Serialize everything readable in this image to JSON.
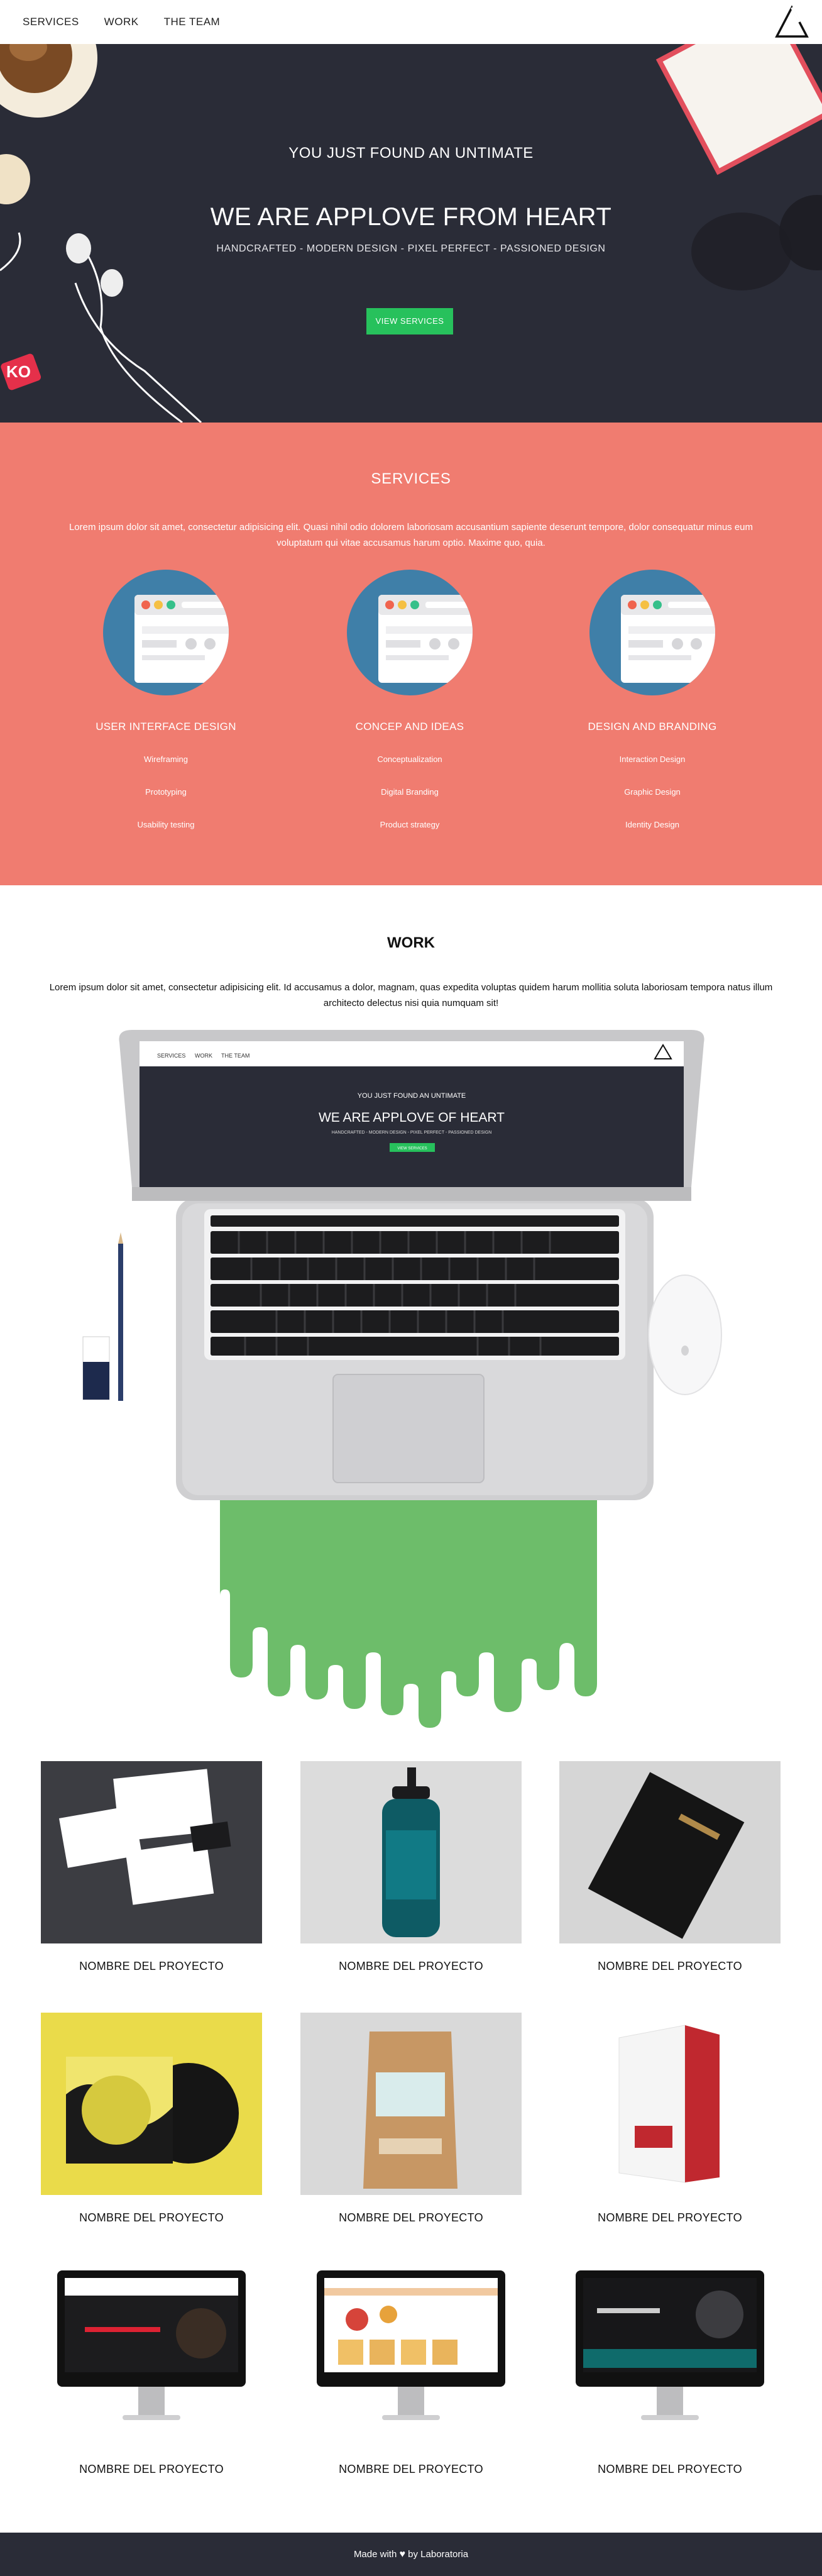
{
  "nav": {
    "items": [
      "SERVICES",
      "WORK",
      "THE TEAM"
    ],
    "logo_icon": "triangle-logo-icon"
  },
  "hero": {
    "pretitle": "YOU JUST FOUND AN UNTIMATE",
    "title": "WE ARE APPLOVE FROM HEART",
    "subtitle": "HANDCRAFTED - MODERN DESIGN - PIXEL PERFECT - PASSIONED DESIGN",
    "button": "VIEW SERVICES",
    "button_color": "#27c15c",
    "background": "#2a2c37"
  },
  "services": {
    "title": "SERVICES",
    "lead": "Lorem ipsum dolor sit amet, consectetur adipisicing elit. Quasi nihil odio dolorem laboriosam accusantium sapiente deserunt tempore, dolor consequatur minus eum voluptatum qui vitae accusamus harum optio. Maxime quo, quia.",
    "background": "#f07c70",
    "columns": [
      {
        "title": "USER INTERFACE DESIGN",
        "items": [
          "Wireframing",
          "Prototyping",
          "Usability testing"
        ]
      },
      {
        "title": "CONCEP AND IDEAS",
        "items": [
          "Conceptualization",
          "Digital Branding",
          "Product strategy"
        ]
      },
      {
        "title": "DESIGN AND BRANDING",
        "items": [
          "Interaction Design",
          "Graphic Design",
          "Identity Design"
        ]
      }
    ]
  },
  "work": {
    "title": "WORK",
    "lead": "Lorem ipsum dolor sit amet, consectetur adipisicing elit. Id accusamus a dolor, magnam, quas expedita voluptas quidem harum mollitia soluta laboriosam tempora natus illum architecto delectus nisi quia numquam sit!",
    "screen": {
      "nav": [
        "SERVICES",
        "WORK",
        "THE TEAM"
      ],
      "pretitle": "YOU JUST FOUND AN UNTIMATE",
      "title": "WE ARE APPLOVE OF HEART",
      "subtitle": "HANDCRAFTED - MODERN DESIGN - PIXEL PERFECT - PASSIONED DESIGN",
      "button": "VIEW SERVICES"
    },
    "projects": [
      {
        "name": "NOMBRE DEL PROYECTO",
        "kind": "stationery"
      },
      {
        "name": "NOMBRE DEL PROYECTO",
        "kind": "bottle"
      },
      {
        "name": "NOMBRE DEL PROYECTO",
        "kind": "black-book"
      },
      {
        "name": "NOMBRE DEL PROYECTO",
        "kind": "vinyl"
      },
      {
        "name": "NOMBRE DEL PROYECTO",
        "kind": "coffee-bag"
      },
      {
        "name": "NOMBRE DEL PROYECTO",
        "kind": "box"
      },
      {
        "name": "NOMBRE DEL PROYECTO",
        "kind": "monitor-speakers"
      },
      {
        "name": "NOMBRE DEL PROYECTO",
        "kind": "monitor-shop"
      },
      {
        "name": "NOMBRE DEL PROYECTO",
        "kind": "monitor-dark"
      }
    ]
  },
  "footer": {
    "made": "Made with",
    "heart_icon": "heart-icon",
    "by": "by Laboratoria"
  }
}
